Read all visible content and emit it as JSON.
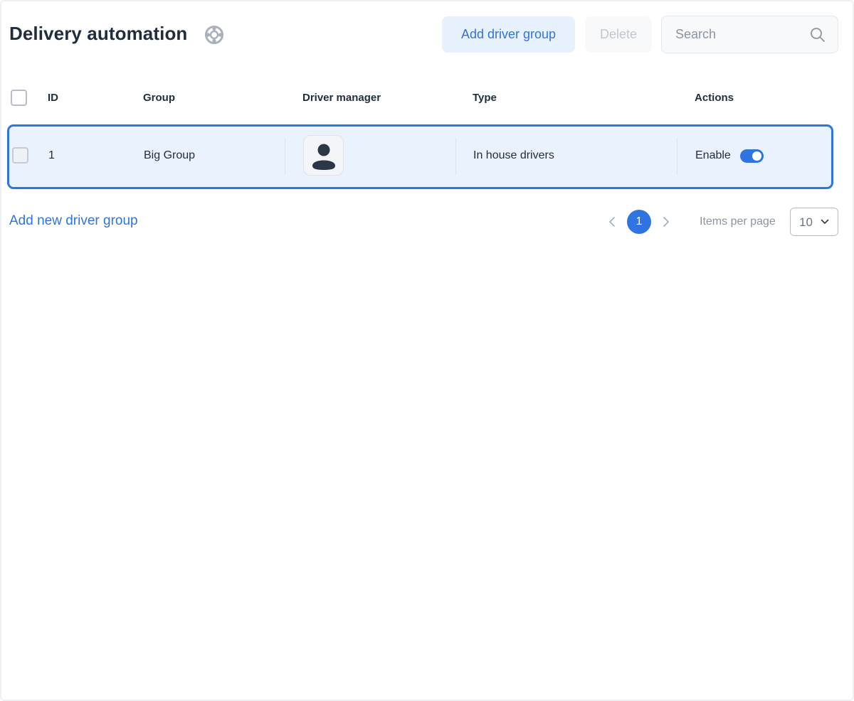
{
  "header": {
    "title": "Delivery automation",
    "help_icon": "help-lifebuoy-icon",
    "add_button": "Add driver group",
    "delete_button": "Delete",
    "search_placeholder": "Search"
  },
  "table": {
    "columns": [
      "ID",
      "Group",
      "Driver manager",
      "Type",
      "Actions"
    ],
    "rows": [
      {
        "id": "1",
        "group": "Big Group",
        "driver_manager_icon": "user-avatar-icon",
        "type": "In house drivers",
        "action_label": "Enable",
        "enabled": true
      }
    ]
  },
  "footer": {
    "add_link": "Add new driver group",
    "current_page": "1",
    "items_per_page_label": "Items per page",
    "items_per_page_value": "10"
  },
  "colors": {
    "accent": "#2f74e0",
    "row_highlight": "#eaf2fe",
    "add_button_bg": "#e8f1fe"
  }
}
